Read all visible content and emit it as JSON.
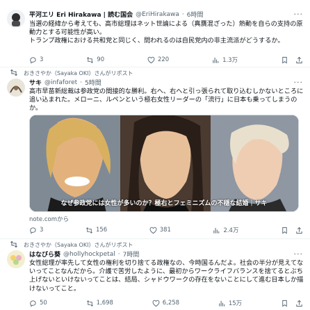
{
  "tweets": [
    {
      "author": {
        "name": "平河エリ Eri Hirakawa | 読む国会",
        "handle": "@EriHirakawa",
        "time": "6時間"
      },
      "text": "当選の経緯から考えても、高市総理はネット世論による（真贋混ざった）熱動を自らの支持の原動力とする可能性が高い。\nトランプ政権における共和党と同じく、問われるのは自民党内の非主流派がどうするか。",
      "stats": {
        "replies": "3",
        "reposts": "90",
        "likes": "220",
        "views": "1.3万"
      }
    },
    {
      "reposted_by": "おきさやか（Sayaka OKI）さんがリポスト",
      "author": {
        "name": "サキ",
        "handle": "@infaforet",
        "time": "5時間"
      },
      "text": "高市早苗新総裁は参政党の間接的な勝利。右へ、右へと引っ張られて取り込むしかないところに追い込まれた。メローニ、ルペンという極右女性リーダーの「流行」に日本も乗ってしまうのか。",
      "media_caption": "なぜ参政党には女性が多いのか？極右とフェミニズムの不穏な結婚｜サキ",
      "card_source": "note.comから",
      "stats": {
        "replies": "3",
        "reposts": "156",
        "likes": "381",
        "views": "2.4万"
      }
    },
    {
      "reposted_by": "おきさやか（Sayaka OKI）さんがリポスト",
      "author": {
        "name": "はなびら葵",
        "handle": "@hollyhockpetal",
        "time": "7時間"
      },
      "text": "女性総理が率先して女性の権利を切り捨てる政権なの、今時国るんだよ。社会の半分が見えてないってことなんだから。介護で苦労したように、最初からワークライフバランスを捨てるとぶち上げないといけないってことは、結局、シャドウワークの存在をないことにして進む日本しか描けないってこと。",
      "stats": {
        "replies": "50",
        "reposts": "1,698",
        "likes": "6,258",
        "views": "15万"
      }
    }
  ],
  "top_repost_label": "おきさやか（Sayaka OKI）さんがリポスト",
  "colors": {
    "text": "#0f1419",
    "muted": "#536471",
    "border": "#eff3f4"
  },
  "icons": [
    "repost-icon",
    "reply-icon",
    "like-icon",
    "views-icon",
    "bookmark-icon",
    "share-icon",
    "more-icon"
  ]
}
